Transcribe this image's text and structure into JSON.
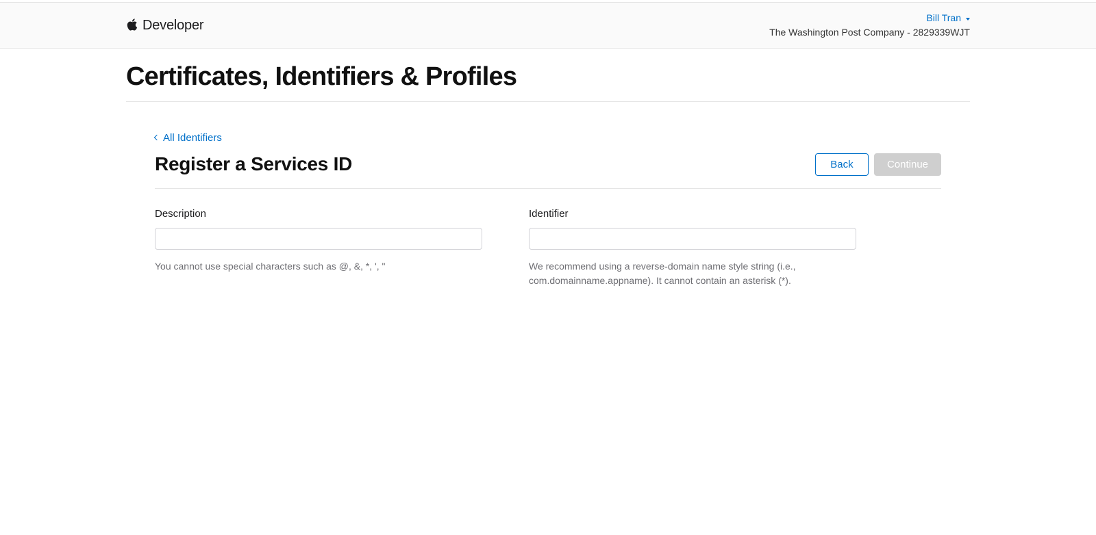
{
  "header": {
    "brand_text": "Developer",
    "account": {
      "name": "Bill Tran",
      "org_line": "The Washington Post Company - 2829339WJT"
    }
  },
  "section_title": "Certificates, Identifiers & Profiles",
  "breadcrumb": {
    "label": "All Identifiers"
  },
  "page_title": "Register a Services ID",
  "buttons": {
    "back": "Back",
    "continue": "Continue"
  },
  "form": {
    "description": {
      "label": "Description",
      "value": "",
      "hint": "You cannot use special characters such as @, &, *, ', \""
    },
    "identifier": {
      "label": "Identifier",
      "value": "",
      "hint": "We recommend using a reverse-domain name style string (i.e., com.domainname.appname). It cannot contain an asterisk (*)."
    }
  }
}
